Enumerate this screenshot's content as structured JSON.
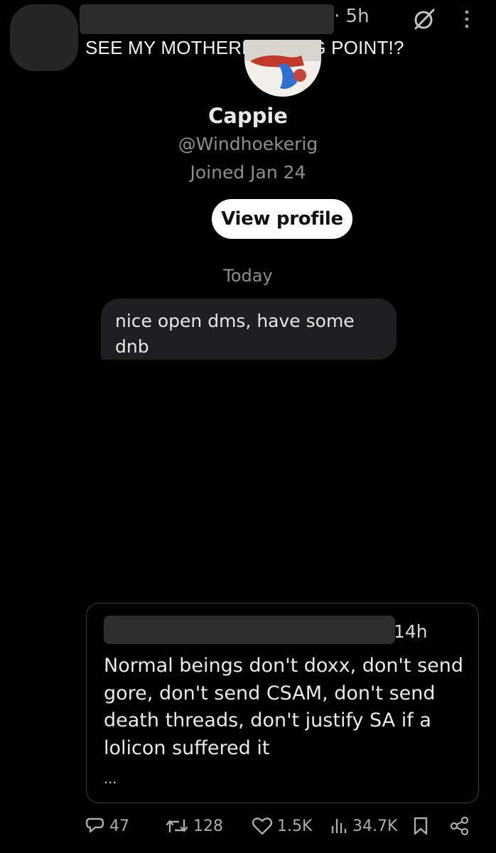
{
  "header": {
    "time": "· 5h",
    "headline": "SEE MY MOTHERFUCKING POINT!?"
  },
  "dm": {
    "name": "Cappie",
    "handle": "@Windhoekerig",
    "joined": "Joined Jan 24",
    "view_profile_label": "View profile",
    "day_label": "Today",
    "message": "nice open dms, have some dnb"
  },
  "quote": {
    "time": "14h",
    "text": "Normal beings don't doxx, don't send gore, don't send CSAM, don't send death threads, don't justify SA if a lolicon suffered it",
    "more": "..."
  },
  "actions": {
    "replies": "47",
    "reposts": "128",
    "likes": "1.5K",
    "views": "34.7K"
  },
  "icons": [
    "grok-icon",
    "more-icon",
    "reply-icon",
    "repost-icon",
    "like-icon",
    "views-icon",
    "bookmark-icon",
    "share-icon"
  ]
}
